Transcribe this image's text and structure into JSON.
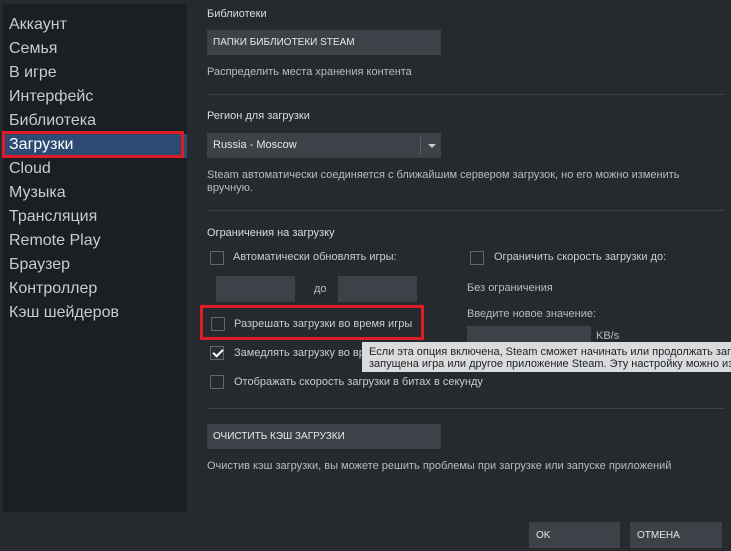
{
  "sidebar": {
    "items": [
      {
        "label": "Аккаунт"
      },
      {
        "label": "Семья"
      },
      {
        "label": "В игре"
      },
      {
        "label": "Интерфейс"
      },
      {
        "label": "Библиотека"
      },
      {
        "label": "Загрузки"
      },
      {
        "label": "Cloud"
      },
      {
        "label": "Музыка"
      },
      {
        "label": "Трансляция"
      },
      {
        "label": "Remote Play"
      },
      {
        "label": "Браузер"
      },
      {
        "label": "Контроллер"
      },
      {
        "label": "Кэш шейдеров"
      }
    ],
    "active": "Загрузки"
  },
  "library": {
    "title": "Библиотеки",
    "button": "ПАПКИ БИБЛИОТЕКИ STEAM",
    "desc": "Распределить места хранения контента"
  },
  "region": {
    "title": "Регион для загрузки",
    "selected": "Russia - Moscow",
    "desc_line1": "Steam автоматически соединяется с ближайшим сервером загрузок, но его можно изменить",
    "desc_line2": "вручную."
  },
  "restrictions": {
    "title": "Ограничения на загрузку",
    "auto_update": "Автоматически обновлять игры:",
    "between_label": "до",
    "limit_speed": "Ограничить скорость загрузки до:",
    "no_limit": "Без ограничения",
    "enter_value": "Введите новое значение:",
    "unit": "KB/s",
    "allow_during_game": "Разрешать загрузки во время игры",
    "throttle": "Замедлять загрузку во вр",
    "throttle_checked": true,
    "show_bits": "Отображать скорость загрузки в битах в секунду"
  },
  "tooltip": {
    "line1": "Если эта опция включена, Steam сможет начинать или продолжать заг",
    "line2": "запущена игра или другое приложение Steam. Эту настройку можно из"
  },
  "cache": {
    "button": "ОЧИСТИТЬ КЭШ ЗАГРУЗКИ",
    "desc": "Очистив кэш загрузки, вы можете решить проблемы при загрузке или запуске приложений"
  },
  "footer": {
    "ok": "OK",
    "cancel": "ОТМЕНА"
  },
  "colors": {
    "accent_active": "#2d4a73",
    "highlight": "#e01c26"
  }
}
